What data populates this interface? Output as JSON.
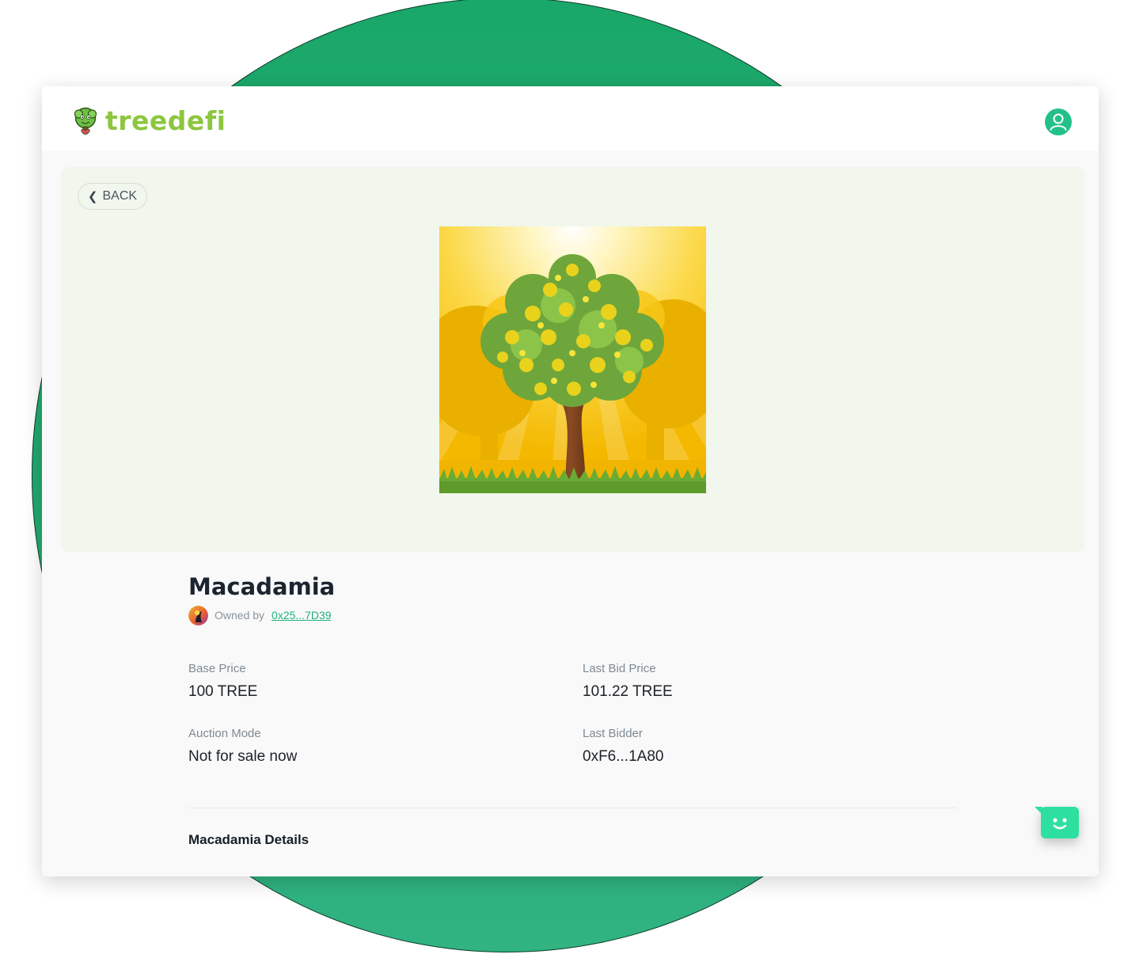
{
  "brand": {
    "name": "treedefi"
  },
  "header": {
    "profile_icon": "user-icon"
  },
  "back_button": {
    "label": "BACK"
  },
  "nft": {
    "name": "Macadamia",
    "owner_label": "Owned by",
    "owner_address": "0x25...7D39"
  },
  "stats": {
    "base_price": {
      "label": "Base Price",
      "value": "100 TREE"
    },
    "last_bid_price": {
      "label": "Last Bid Price",
      "value": "101.22 TREE"
    },
    "auction_mode": {
      "label": "Auction Mode",
      "value": "Not for sale now"
    },
    "last_bidder": {
      "label": "Last Bidder",
      "value": "0xF6...1A80"
    }
  },
  "details": {
    "heading": "Macadamia Details"
  },
  "colors": {
    "brand_green": "#8dc63f",
    "accent": "#23c187",
    "background_circle": "#1aa86a",
    "chat_button": "#2ee0a0"
  }
}
